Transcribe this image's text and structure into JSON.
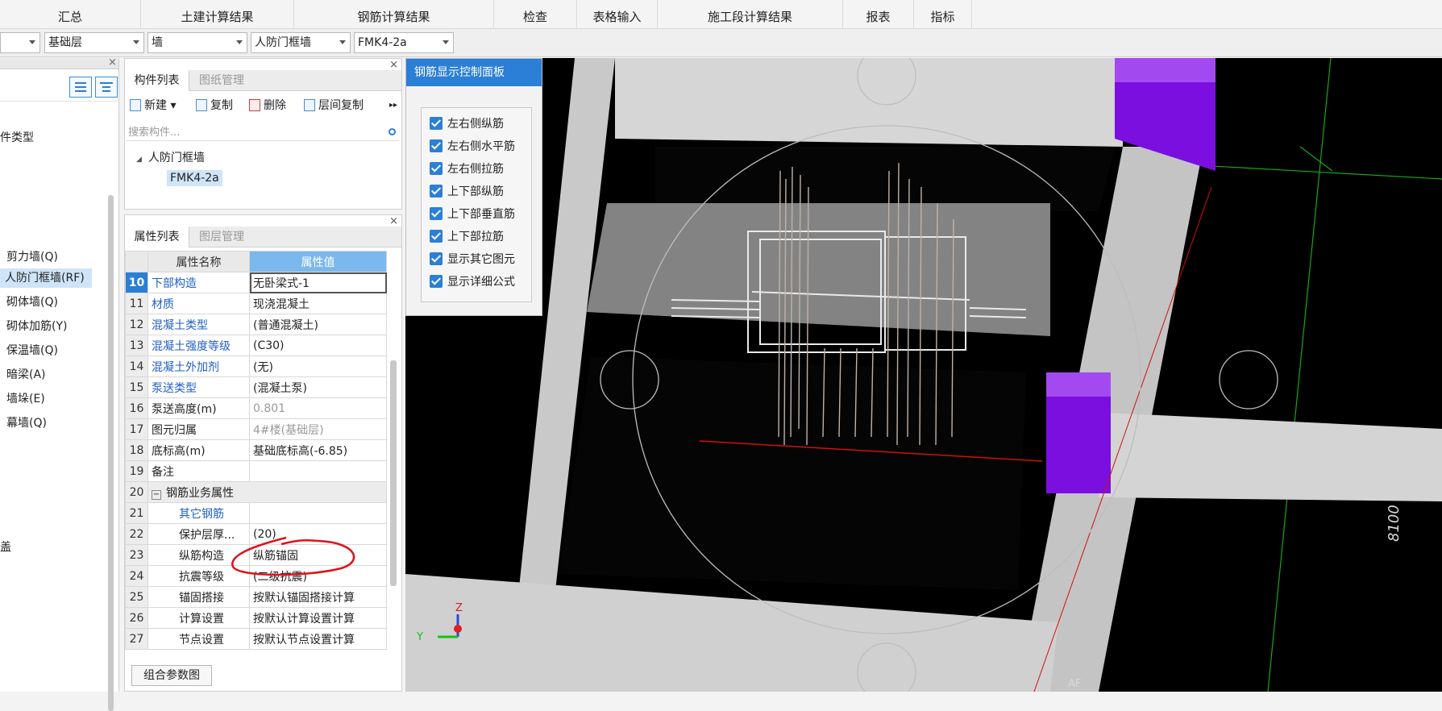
{
  "menu": [
    "汇总",
    "土建计算结果",
    "钢筋计算结果",
    "检查",
    "表格输入",
    "施工段计算结果",
    "报表",
    "指标"
  ],
  "toolbar": {
    "floor": "基础层",
    "category": "墙",
    "type": "人防门框墙",
    "component": "FMK4-2a"
  },
  "left_panel": {
    "header_partial": "件类型",
    "items": [
      "剪力墙(Q)",
      "人防门框墙(RF)",
      "砌体墙(Q)",
      "砌体加筋(Y)",
      "保温墙(Q)",
      "暗梁(A)",
      "墙垛(E)",
      "幕墙(Q)"
    ],
    "selected_index": 1,
    "bottom_partial": "盖"
  },
  "component_panel": {
    "tabs": [
      "构件列表",
      "图纸管理"
    ],
    "actions": [
      "新建",
      "复制",
      "删除",
      "层间复制"
    ],
    "search_placeholder": "搜索构件...",
    "tree_root": "人防门框墙",
    "tree_leaf": "FMK4-2a"
  },
  "attribute_panel": {
    "tabs": [
      "属性列表",
      "图层管理"
    ],
    "col_name": "属性名称",
    "col_value": "属性值",
    "rows": [
      {
        "n": "10",
        "name": "下部构造",
        "value": "无卧梁式-1"
      },
      {
        "n": "11",
        "name": "材质",
        "value": "现浇混凝土"
      },
      {
        "n": "12",
        "name": "混凝土类型",
        "value": "(普通混凝土)"
      },
      {
        "n": "13",
        "name": "混凝土强度等级",
        "value": "(C30)"
      },
      {
        "n": "14",
        "name": "混凝土外加剂",
        "value": "(无)"
      },
      {
        "n": "15",
        "name": "泵送类型",
        "value": "(混凝土泵)"
      },
      {
        "n": "16",
        "name": "泵送高度(m)",
        "value": "0.801"
      },
      {
        "n": "17",
        "name": "图元归属",
        "value": "4#楼(基础层)"
      },
      {
        "n": "18",
        "name": "底标高(m)",
        "value": "基础底标高(-6.85)"
      },
      {
        "n": "19",
        "name": "备注",
        "value": ""
      },
      {
        "n": "20",
        "name": "钢筋业务属性",
        "value": ""
      },
      {
        "n": "21",
        "name": "其它钢筋",
        "value": ""
      },
      {
        "n": "22",
        "name": "保护层厚...",
        "value": "(20)"
      },
      {
        "n": "23",
        "name": "纵筋构造",
        "value": "纵筋锚固"
      },
      {
        "n": "24",
        "name": "抗震等级",
        "value": "(二级抗震)"
      },
      {
        "n": "25",
        "name": "锚固搭接",
        "value": "按默认锚固搭接计算"
      },
      {
        "n": "26",
        "name": "计算设置",
        "value": "按默认计算设置计算"
      },
      {
        "n": "27",
        "name": "节点设置",
        "value": "按默认节点设置计算"
      }
    ],
    "combine_button": "组合参数图"
  },
  "rebar_panel": {
    "title": "钢筋显示控制面板",
    "options": [
      "左右侧纵筋",
      "左右侧水平筋",
      "左右侧拉筋",
      "上下部纵筋",
      "上下部垂直筋",
      "上下部拉筋",
      "显示其它图元",
      "显示详细公式"
    ]
  },
  "viewport": {
    "dimension_label": "8100",
    "axis_y": "Y",
    "axis_z": "Z",
    "corner_label": "AF"
  },
  "colors": {
    "accent": "#2b7fd6",
    "purple_block": "#7a0fe0",
    "annotation_red": "#e0101a"
  }
}
